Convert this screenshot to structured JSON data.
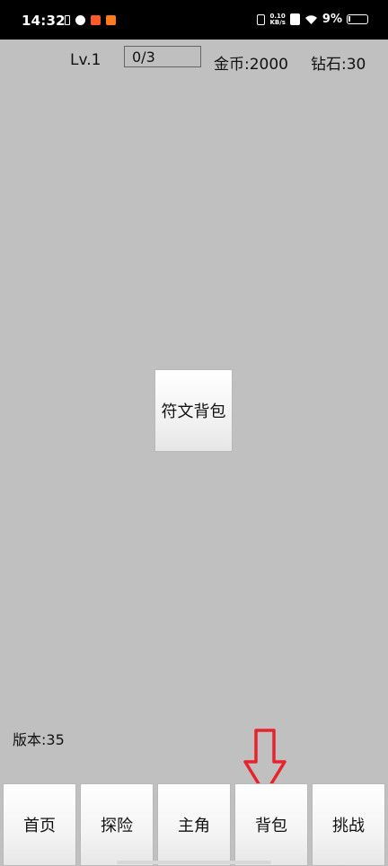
{
  "status_bar": {
    "time": "14:32",
    "net_speed_value": "0.10",
    "net_speed_unit": "KB/s",
    "battery_percent": "9%"
  },
  "header": {
    "level": "Lv.1",
    "progress": "0/3",
    "gold": "金币:2000",
    "diamonds": "钻石:30"
  },
  "main": {
    "rune_bag_label": "符文背包"
  },
  "footer": {
    "version": "版本:35"
  },
  "nav": {
    "items": [
      {
        "label": "首页"
      },
      {
        "label": "探险"
      },
      {
        "label": "主角"
      },
      {
        "label": "背包"
      },
      {
        "label": "挑战"
      }
    ]
  },
  "annotation": {
    "arrow_color": "#e8232c"
  }
}
